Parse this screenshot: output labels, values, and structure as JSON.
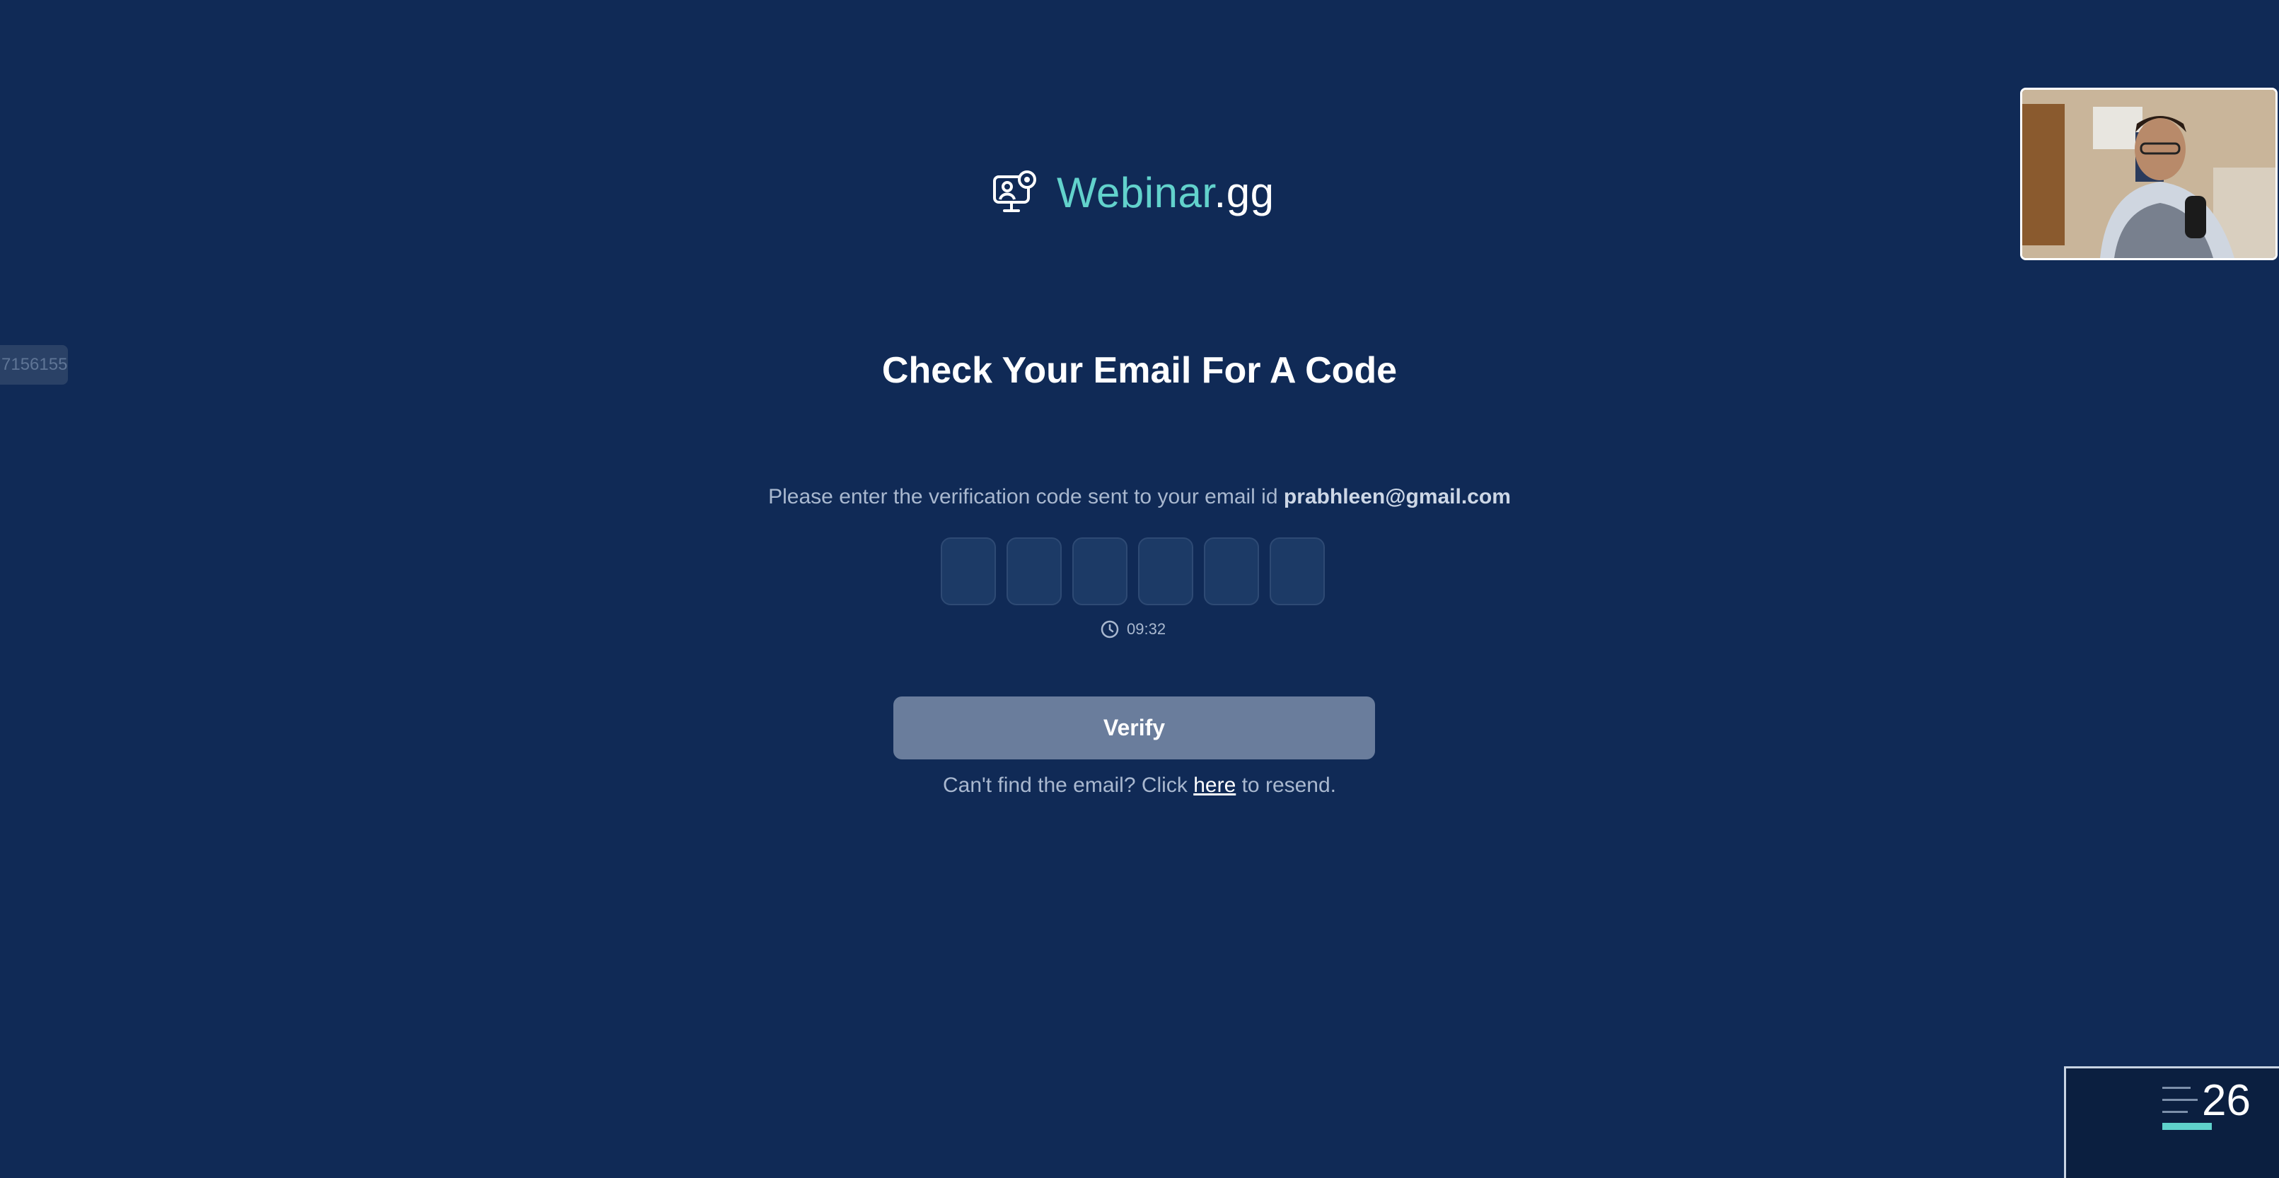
{
  "side_tag": "7156155",
  "brand": {
    "name": "Webinar",
    "tld": ".gg",
    "icon": "monitor-user-icon",
    "accent_color": "#62d2cc"
  },
  "heading": "Check Your Email For A Code",
  "instruction": {
    "text": "Please enter the verification code sent to your email id",
    "email": "prabhleen@gmail.com"
  },
  "code_inputs": [
    "",
    "",
    "",
    "",
    "",
    ""
  ],
  "timer": {
    "icon": "clock-icon",
    "value": "09:32"
  },
  "verify_button": "Verify",
  "resend": {
    "prefix": "Can't find the email? Click",
    "link": "here",
    "suffix": "to resend."
  },
  "slide_preview": {
    "number": "26"
  },
  "colors": {
    "background": "#102a56",
    "button": "#6a7d9c"
  }
}
